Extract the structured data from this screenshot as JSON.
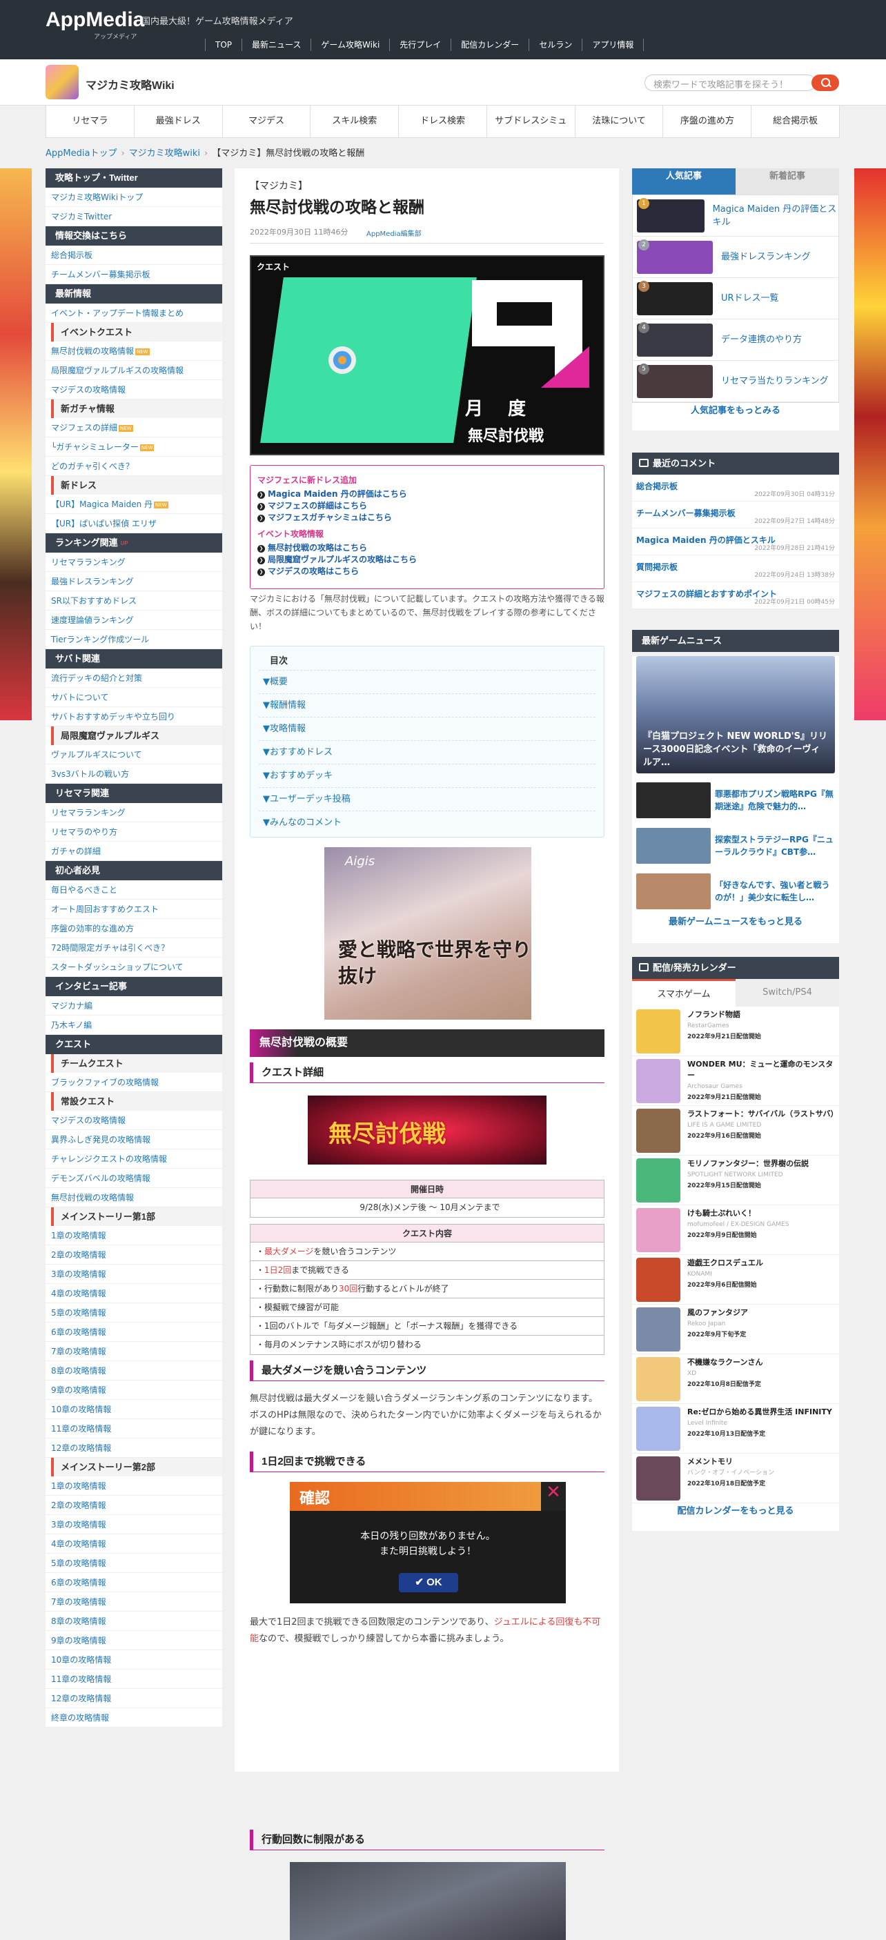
{
  "topbar": {
    "logo": "AppMedia",
    "logo_sub": "アップメディア",
    "tagline": "国内最大級！ゲーム攻略情報メディア",
    "nav": [
      "TOP",
      "最新ニュース",
      "ゲーム攻略Wiki",
      "先行プレイ",
      "配信カレンダー",
      "セルラン",
      "アプリ情報"
    ]
  },
  "site": {
    "name": "マジカミ攻略Wiki",
    "search_placeholder": "検索ワードで攻略記事を探そう！"
  },
  "tabs": [
    "リセマラ",
    "最強ドレス",
    "マジデス",
    "スキル検索",
    "ドレス検索",
    "サブドレスシミュ",
    "法珠について",
    "序盤の進め方",
    "総合掲示板"
  ],
  "breadcrumb": {
    "home": "AppMediaトップ",
    "wiki": "マジカミ攻略wiki",
    "current": "【マジカミ】無尽討伐戦の攻略と報酬"
  },
  "left_sidebar": [
    {
      "type": "h",
      "text": "攻略トップ・Twitter"
    },
    {
      "type": "i",
      "text": "マジカミ攻略Wikiトップ"
    },
    {
      "type": "i",
      "text": "マジカミTwitter"
    },
    {
      "type": "h",
      "text": "情報交換はこちら"
    },
    {
      "type": "i",
      "text": "総合掲示板"
    },
    {
      "type": "i",
      "text": "チームメンバー募集掲示板"
    },
    {
      "type": "h",
      "text": "最新情報"
    },
    {
      "type": "i",
      "text": "イベント・アップデート情報まとめ"
    },
    {
      "type": "s",
      "text": "イベントクエスト"
    },
    {
      "type": "i",
      "text": "無尽討伐戦の攻略情報",
      "tag": "NEW"
    },
    {
      "type": "i",
      "text": "局限魔窟ヴァルプルギスの攻略情報"
    },
    {
      "type": "i",
      "text": "マジデスの攻略情報"
    },
    {
      "type": "s",
      "text": "新ガチャ情報"
    },
    {
      "type": "i",
      "text": "マジフェスの詳細",
      "tag": "NEW"
    },
    {
      "type": "i",
      "text": "└ガチャシミュレーター",
      "tag": "NEW"
    },
    {
      "type": "i",
      "text": "どのガチャ引くべき？"
    },
    {
      "type": "s",
      "text": "新ドレス"
    },
    {
      "type": "i",
      "text": "【UR】Magica Maiden 丹",
      "tag": "NEW"
    },
    {
      "type": "i",
      "text": "【UR】ぱいぱい探偵 エリザ"
    },
    {
      "type": "h",
      "text": "ランキング関連",
      "tag": "UP"
    },
    {
      "type": "i",
      "text": "リセマラランキング"
    },
    {
      "type": "i",
      "text": "最強ドレスランキング"
    },
    {
      "type": "i",
      "text": "SR以下おすすめドレス"
    },
    {
      "type": "i",
      "text": "速度理論値ランキング"
    },
    {
      "type": "i",
      "text": "Tierランキング作成ツール"
    },
    {
      "type": "h",
      "text": "サバト関連"
    },
    {
      "type": "i",
      "text": "流行デッキの紹介と対策"
    },
    {
      "type": "i",
      "text": "サバトについて"
    },
    {
      "type": "i",
      "text": "サバトおすすめデッキや立ち回り"
    },
    {
      "type": "s",
      "text": "局限魔窟ヴァルプルギス"
    },
    {
      "type": "i",
      "text": "ヴァルプルギスについて"
    },
    {
      "type": "i",
      "text": "3vs3バトルの戦い方"
    },
    {
      "type": "h",
      "text": "リセマラ関連"
    },
    {
      "type": "i",
      "text": "リセマラランキング"
    },
    {
      "type": "i",
      "text": "リセマラのやり方"
    },
    {
      "type": "i",
      "text": "ガチャの詳細"
    },
    {
      "type": "h",
      "text": "初心者必見"
    },
    {
      "type": "i",
      "text": "毎日やるべきこと"
    },
    {
      "type": "i",
      "text": "オート周回おすすめクエスト"
    },
    {
      "type": "i",
      "text": "序盤の効率的な進め方"
    },
    {
      "type": "i",
      "text": "72時間限定ガチャは引くべき？"
    },
    {
      "type": "i",
      "text": "スタートダッシュショップについて"
    },
    {
      "type": "h",
      "text": "インタビュー記事"
    },
    {
      "type": "i",
      "text": "マジカナ編"
    },
    {
      "type": "i",
      "text": "乃木キノ編"
    },
    {
      "type": "h",
      "text": "クエスト"
    },
    {
      "type": "s",
      "text": "チームクエスト"
    },
    {
      "type": "i",
      "text": "ブラックファイブの攻略情報"
    },
    {
      "type": "s",
      "text": "常設クエスト"
    },
    {
      "type": "i",
      "text": "マジデスの攻略情報"
    },
    {
      "type": "i",
      "text": "異界ふしぎ発見の攻略情報"
    },
    {
      "type": "i",
      "text": "チャレンジクエストの攻略情報"
    },
    {
      "type": "i",
      "text": "デモンズバベルの攻略情報"
    },
    {
      "type": "i",
      "text": "無尽討伐戦の攻略情報"
    },
    {
      "type": "s",
      "text": "メインストーリー第1部"
    },
    {
      "type": "i",
      "text": "1章の攻略情報"
    },
    {
      "type": "i",
      "text": "2章の攻略情報"
    },
    {
      "type": "i",
      "text": "3章の攻略情報"
    },
    {
      "type": "i",
      "text": "4章の攻略情報"
    },
    {
      "type": "i",
      "text": "5章の攻略情報"
    },
    {
      "type": "i",
      "text": "6章の攻略情報"
    },
    {
      "type": "i",
      "text": "7章の攻略情報"
    },
    {
      "type": "i",
      "text": "8章の攻略情報"
    },
    {
      "type": "i",
      "text": "9章の攻略情報"
    },
    {
      "type": "i",
      "text": "10章の攻略情報"
    },
    {
      "type": "i",
      "text": "11章の攻略情報"
    },
    {
      "type": "i",
      "text": "12章の攻略情報"
    },
    {
      "type": "s",
      "text": "メインストーリー第2部"
    },
    {
      "type": "i",
      "text": "1章の攻略情報"
    },
    {
      "type": "i",
      "text": "2章の攻略情報"
    },
    {
      "type": "i",
      "text": "3章の攻略情報"
    },
    {
      "type": "i",
      "text": "4章の攻略情報"
    },
    {
      "type": "i",
      "text": "5章の攻略情報"
    },
    {
      "type": "i",
      "text": "6章の攻略情報"
    },
    {
      "type": "i",
      "text": "7章の攻略情報"
    },
    {
      "type": "i",
      "text": "8章の攻略情報"
    },
    {
      "type": "i",
      "text": "9章の攻略情報"
    },
    {
      "type": "i",
      "text": "10章の攻略情報"
    },
    {
      "type": "i",
      "text": "11章の攻略情報"
    },
    {
      "type": "i",
      "text": "12章の攻略情報"
    },
    {
      "type": "i",
      "text": "終章の攻略情報"
    }
  ],
  "article": {
    "kicker": "【マジカミ】",
    "title": "無尽討伐戦の攻略と報酬",
    "date": "2022年09月30日 11時46分",
    "author": "AppMedia編集部",
    "hero": {
      "logo": "クエスト",
      "label": "月度",
      "sub": "無尽討伐戦"
    },
    "promo": {
      "h1": "マジフェスに新ドレス追加",
      "links1": [
        "Magica Maiden 丹の評価はこちら",
        "マジフェスの詳細はこちら",
        "マジフェスガチャシミュはこちら"
      ],
      "h2": "イベント攻略情報",
      "links2": [
        "無尽討伐戦の攻略はこちら",
        "局限魔窟ヴァルプルギスの攻略はこちら",
        "マジデスの攻略はこちら"
      ]
    },
    "intro": "マジカミにおける「無尽討伐戦」について記載しています。クエストの攻略方法や獲得できる報酬、ボスの詳細についてもまとめているので、無尽討伐戦をプレイする際の参考にしてください！",
    "toc_title": "目次",
    "toc": [
      "▼概要",
      "▼報酬情報",
      "▼攻略情報",
      "▼おすすめドレス",
      "▼おすすめデッキ",
      "▼ユーザーデッキ投稿",
      "▼みんなのコメント"
    ],
    "ad_text": "愛と戦略で世界を守り抜け",
    "ad_logo": "Aigis",
    "section_h2": "無尽討伐戦の概要",
    "h3_quest": "クエスト詳細",
    "quest_img_text": "無尽討伐戦",
    "schedule_header": "開催日時",
    "schedule_value": "9/28(水)メンテ後 〜 10月メンテまで",
    "content_header": "クエスト内容",
    "content_rows": [
      {
        "pre": "・",
        "hl": "最大ダメージ",
        "post": "を競い合うコンテンツ"
      },
      {
        "pre": "・",
        "hl": "1日2回",
        "post": "まで挑戦できる"
      },
      {
        "pre": "・行動数に制限があり",
        "hl": "30回",
        "post": "行動するとバトルが終了"
      },
      {
        "pre": "・模擬戦で練習が可能",
        "hl": "",
        "post": ""
      },
      {
        "pre": "・1回のバトルで「与ダメージ報酬」と「ボーナス報酬」を獲得できる",
        "hl": "",
        "post": ""
      },
      {
        "pre": "・毎月のメンテナンス時にボスが切り替わる",
        "hl": "",
        "post": ""
      }
    ],
    "h3_max": "最大ダメージを競い合うコンテンツ",
    "max_text": "無尽討伐戦は最大ダメージを競い合うダメージランキング系のコンテンツになります。ボスのHPは無限なので、決められたターン内でいかに効率よくダメージを与えられるかが鍵になります。",
    "h3_twice": "1日2回まで挑戦できる",
    "confirm": {
      "title": "確認",
      "line1": "本日の残り回数がありません。",
      "line2": "また明日挑戦しよう！",
      "ok": "OK"
    },
    "twice_text_pre": "最大で1日2回まで挑戦できる回数限定のコンテンツであり、",
    "twice_text_hl": "ジュエルによる回復も不可能",
    "twice_text_post": "なので、模擬戦でしっかり練習してから本番に挑みましょう。",
    "h3_limit": "行動回数に制限がある"
  },
  "right": {
    "tab_popular": "人気記事",
    "tab_new": "新着記事",
    "popular": [
      {
        "rank": "1",
        "title": "Magica Maiden 丹の評価とスキル",
        "color": "#2a2a3a",
        "rank_color": "#e0a23a"
      },
      {
        "rank": "2",
        "title": "最強ドレスランキング",
        "color": "#8a4ab8",
        "rank_color": "#9aa0a8"
      },
      {
        "rank": "3",
        "title": "URドレス一覧",
        "color": "#222",
        "rank_color": "#b07a4a"
      },
      {
        "rank": "4",
        "title": "データ連携のやり方",
        "color": "#3a3a44",
        "rank_color": "#777"
      },
      {
        "rank": "5",
        "title": "リセマラ当たりランキング",
        "color": "#4a3a3e",
        "rank_color": "#777"
      }
    ],
    "popular_more": "人気記事をもっとみる",
    "comments_title": "最近のコメント",
    "comments": [
      {
        "title": "総合掲示板",
        "date": "2022年09月30日 04時31分"
      },
      {
        "title": "チームメンバー募集掲示板",
        "date": "2022年09月27日 14時48分"
      },
      {
        "title": "Magica Maiden 丹の評価とスキル",
        "date": "2022年09月28日 21時41分"
      },
      {
        "title": "質問掲示板",
        "date": "2022年09月24日 13時38分"
      },
      {
        "title": "マジフェスの詳細とおすすめポイント",
        "date": "2022年09月21日 00時45分"
      }
    ],
    "news_title": "最新ゲームニュース",
    "news_big": "『白猫プロジェクト NEW WORLD'S』リリース3000日記念イベント「救命のイーヴィルア…",
    "news": [
      {
        "title": "罪悪都市プリズン戦略RPG『無期迷途』危険で魅力的…",
        "color": "#2a2a2a"
      },
      {
        "title": "探索型ストラテジーRPG『ニューラルクラウド』CBT参…",
        "color": "#6a8aa8"
      },
      {
        "title": "「好きなんです、強い者と戦うのが！」美少女に転生し…",
        "color": "#b88a6a"
      }
    ],
    "news_more": "最新ゲームニュースをもっと見る",
    "cal_title": "配信/発売カレンダー",
    "cal_tab_sp": "スマホゲーム",
    "cal_tab_sw": "Switch/PS4",
    "calendar": [
      {
        "name": "ノフランド物語",
        "pub": "RestarGames",
        "date": "2022年9月21日配信開始",
        "color": "#f2c44a"
      },
      {
        "name": "WONDER MU：ミューと運命のモンスター",
        "pub": "Archosaur Games",
        "date": "2022年9月21日配信開始",
        "color": "#c9a9e0"
      },
      {
        "name": "ラストフォート：サバイバル（ラストサバ）",
        "pub": "LIFE IS A GAME LIMITED",
        "date": "2022年9月16日配信開始",
        "color": "#8a6a4a"
      },
      {
        "name": "モリノファンタジー：世界樹の伝説",
        "pub": "SPOTLIGHT NETWORK LIMITED",
        "date": "2022年9月15日配信開始",
        "color": "#4ab87a"
      },
      {
        "name": "けも騎士ぷれいく！",
        "pub": "mofumofeel / EX-DESIGN GAMES",
        "date": "2022年9月9日配信開始",
        "color": "#e8a0c8"
      },
      {
        "name": "遊戯王クロスデュエル",
        "pub": "KONAMI",
        "date": "2022年9月6日配信開始",
        "color": "#c84a2a"
      },
      {
        "name": "風のファンタジア",
        "pub": "Rekoo Japan",
        "date": "2022年9月下旬予定",
        "color": "#7a8aa8"
      },
      {
        "name": "不機嫌なラクーンさん",
        "pub": "XD",
        "date": "2022年10月8日配信予定",
        "color": "#f2c87a"
      },
      {
        "name": "Re:ゼロから始める異世界生活 INFINITY",
        "pub": "Level Infinite",
        "date": "2022年10月13日配信予定",
        "color": "#a8b8e8"
      },
      {
        "name": "メメントモリ",
        "pub": "バンク・オブ・イノベーション",
        "date": "2022年10月18日配信予定",
        "color": "#6a4a5a"
      }
    ],
    "cal_more": "配信カレンダーをもっと見る"
  }
}
